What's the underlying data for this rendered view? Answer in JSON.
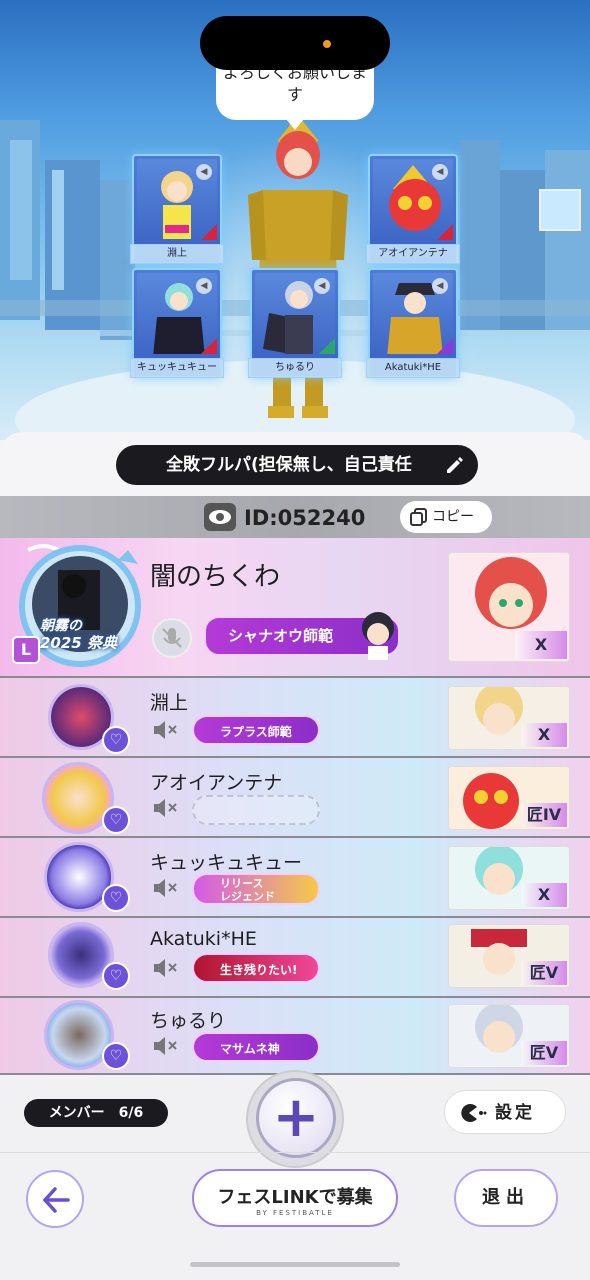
{
  "scene": {
    "speech_text": "よろしくお願いしま\nす",
    "cards": [
      {
        "name": "淵上",
        "bg": "#f2c94c"
      },
      {
        "name": "アオイアンテナ",
        "bg": "#e83838"
      },
      {
        "name": "キュッキュキュー",
        "bg": "#6fd6d0"
      },
      {
        "name": "ちゅるり",
        "bg": "#9aa3ff"
      },
      {
        "name": "Akatuki*HE",
        "bg": "#e0b040"
      }
    ]
  },
  "party": {
    "name": "全敗フルパ(担保無し、自己責任",
    "room_id": "ID:052240",
    "copy_label": "コピー"
  },
  "members": [
    {
      "name": "闇のちくわ",
      "title": "シャナオウ師範",
      "rank": "X",
      "leader_badge": "L",
      "event_badge_line1": "朝霧の",
      "event_badge_line2": "2025",
      "event_badge_line3": "祭典"
    },
    {
      "name": "淵上",
      "title": "ラプラス師範",
      "rank": "X"
    },
    {
      "name": "アオイアンテナ",
      "title": "",
      "rank": "匠IV"
    },
    {
      "name": "キュッキュキュー",
      "title": "リリース\nレジェンド",
      "rank": "X"
    },
    {
      "name": "Akatuki*HE",
      "title": "生き残りたい!",
      "rank": "匠V"
    },
    {
      "name": "ちゅるり",
      "title": "マサムネ神",
      "rank": "匠V"
    }
  ],
  "footer": {
    "members_label": "メンバー　6/6",
    "settings_label": "設定",
    "link_label_pre": "フェス",
    "link_label_link": "LINK",
    "link_label_post": "で募集",
    "link_sub": "BY FESTIBATLE",
    "exit_label": "退出",
    "add_symbol": "+"
  }
}
